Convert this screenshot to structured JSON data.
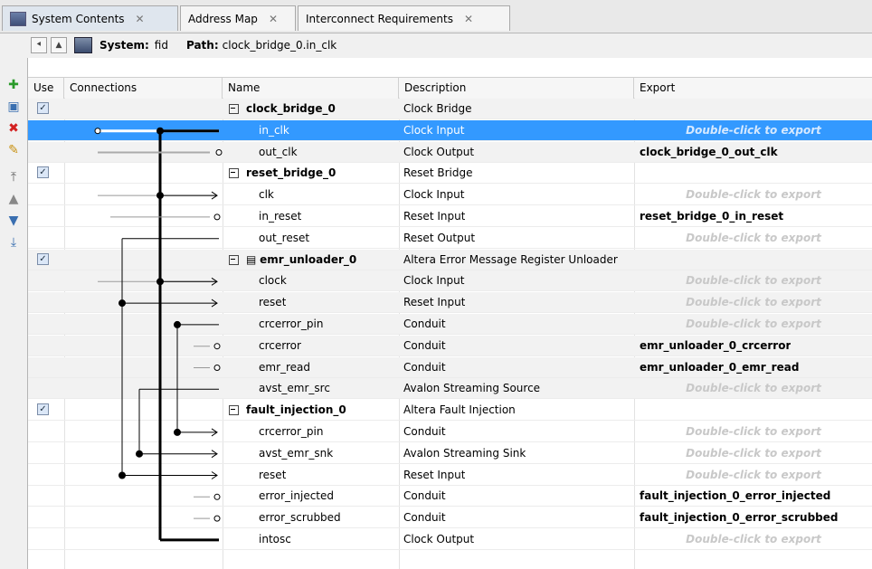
{
  "tabs": [
    {
      "label": "System Contents",
      "active": true
    },
    {
      "label": "Address Map",
      "active": false
    },
    {
      "label": "Interconnect Requirements",
      "active": false
    }
  ],
  "pathbar": {
    "system_label": "System:",
    "system_value": "fid",
    "path_label": "Path:",
    "path_value": "clock_bridge_0.in_clk"
  },
  "columns": {
    "use": "Use",
    "connections": "Connections",
    "name": "Name",
    "description": "Description",
    "export": "Export"
  },
  "export_hint": "Double-click to export",
  "rows": [
    {
      "name": "clock_bridge_0",
      "description": "Clock Bridge",
      "export": "",
      "type": "component",
      "checked": true
    },
    {
      "name": "in_clk",
      "description": "Clock Input",
      "export": "Double-click to export",
      "type": "port",
      "selected": true
    },
    {
      "name": "out_clk",
      "description": "Clock Output",
      "export": "clock_bridge_0_out_clk",
      "type": "port"
    },
    {
      "name": "reset_bridge_0",
      "description": "Reset Bridge",
      "export": "",
      "type": "component",
      "checked": true
    },
    {
      "name": "clk",
      "description": "Clock Input",
      "export": "Double-click to export",
      "type": "port"
    },
    {
      "name": "in_reset",
      "description": "Reset Input",
      "export": "reset_bridge_0_in_reset",
      "type": "port"
    },
    {
      "name": "out_reset",
      "description": "Reset Output",
      "export": "Double-click to export",
      "type": "port"
    },
    {
      "name": "emr_unloader_0",
      "description": "Altera Error Message Register Unloader",
      "export": "",
      "type": "component",
      "checked": true,
      "icon": true
    },
    {
      "name": "clock",
      "description": "Clock Input",
      "export": "Double-click to export",
      "type": "port"
    },
    {
      "name": "reset",
      "description": "Reset Input",
      "export": "Double-click to export",
      "type": "port"
    },
    {
      "name": "crcerror_pin",
      "description": "Conduit",
      "export": "Double-click to export",
      "type": "port"
    },
    {
      "name": "crcerror",
      "description": "Conduit",
      "export": "emr_unloader_0_crcerror",
      "type": "port"
    },
    {
      "name": "emr_read",
      "description": "Conduit",
      "export": "emr_unloader_0_emr_read",
      "type": "port"
    },
    {
      "name": "avst_emr_src",
      "description": "Avalon Streaming Source",
      "export": "Double-click to export",
      "type": "port"
    },
    {
      "name": "fault_injection_0",
      "description": "Altera Fault Injection",
      "export": "",
      "type": "component",
      "checked": true
    },
    {
      "name": "crcerror_pin",
      "description": "Conduit",
      "export": "Double-click to export",
      "type": "port"
    },
    {
      "name": "avst_emr_snk",
      "description": "Avalon Streaming Sink",
      "export": "Double-click to export",
      "type": "port"
    },
    {
      "name": "reset",
      "description": "Reset Input",
      "export": "Double-click to export",
      "type": "port"
    },
    {
      "name": "error_injected",
      "description": "Conduit",
      "export": "fault_injection_0_error_injected",
      "type": "port"
    },
    {
      "name": "error_scrubbed",
      "description": "Conduit",
      "export": "fault_injection_0_error_scrubbed",
      "type": "port"
    },
    {
      "name": "intosc",
      "description": "Clock Output",
      "export": "Double-click to export",
      "type": "port"
    }
  ],
  "colors": {
    "selection": "#3399ff",
    "hint": "#c8c8c8",
    "tab_bg": "#dfe6ee"
  },
  "toolbar_icons": [
    "add-icon",
    "add-component-icon",
    "remove-icon",
    "edit-icon",
    "move-top-icon",
    "move-up-icon",
    "move-down-icon",
    "move-bottom-icon"
  ]
}
